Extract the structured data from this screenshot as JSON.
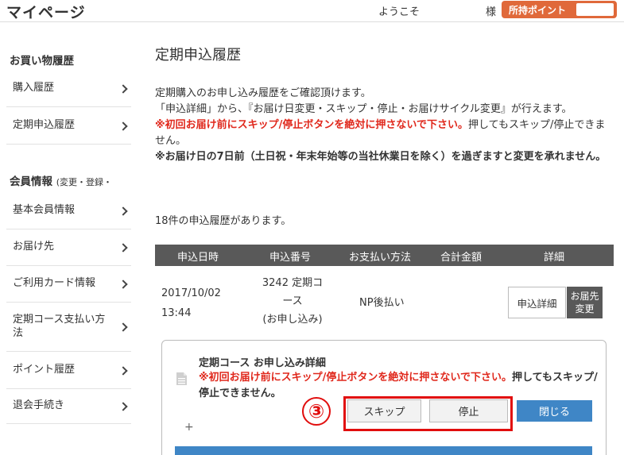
{
  "header": {
    "title": "マイページ",
    "welcome": "ようこそ",
    "honorific": "様",
    "points_label": "所持ポイント",
    "points_value": ""
  },
  "sidebar": {
    "shopping_heading": "お買い物履歴",
    "shopping_items": [
      {
        "label": "購入履歴"
      },
      {
        "label": "定期申込履歴"
      }
    ],
    "member_heading": "会員情報",
    "member_heading_sub": "(変更・登録・",
    "member_items": [
      {
        "label": "基本会員情報"
      },
      {
        "label": "お届け先"
      },
      {
        "label": "ご利用カード情報"
      },
      {
        "label": "定期コース支払い方\n法"
      },
      {
        "label": "ポイント履歴"
      },
      {
        "label": "退会手続き"
      }
    ]
  },
  "main": {
    "title": "定期申込履歴",
    "intro_line1": "定期購入のお申し込み履歴をご確認頂けます。",
    "intro_line2": "「申込詳細」から、『お届け日変更・スキップ・停止・お届けサイクル変更』が行えます。",
    "warn1_red": "※初回お届け前にスキップ/停止ボタンを絶対に押さないで下さい。",
    "warn1_rest": "押してもスキップ/停止できません。",
    "warn2": "※お届け日の7日前（土日祝・年末年始等の当社休業日を除く）を過ぎますと変更を承れません。",
    "count_text": "18件の申込履歴があります。"
  },
  "table": {
    "headers": [
      "申込日時",
      "申込番号",
      "お支払い方法",
      "合計金額",
      "詳細"
    ],
    "row": {
      "date": "2017/10/02",
      "time": "13:44",
      "order_line1": "3242 定期コ",
      "order_line2": "ース",
      "order_line3": "(お申し込み)",
      "payment": "NP後払い",
      "total": "",
      "detail_button": "申込詳細",
      "address_button_line1": "お届先",
      "address_button_line2": "変更"
    }
  },
  "panel": {
    "title": "定期コース お申し込み詳細",
    "warn_red": "※初回お届け前にスキップ/停止ボタンを絶対に押さないで下さい。",
    "warn_dark": "押してもスキップ/停止できません。",
    "skip_label": "スキップ",
    "stop_label": "停止",
    "close_label": "閉じる",
    "plus": "+"
  },
  "annotation": {
    "step_number": "③",
    "highlight_color": "#e10e0e"
  },
  "colors": {
    "accent_orange": "#e0693a",
    "table_header": "#595959",
    "warning_red": "#e0281c",
    "button_blue": "#3f86c6"
  }
}
